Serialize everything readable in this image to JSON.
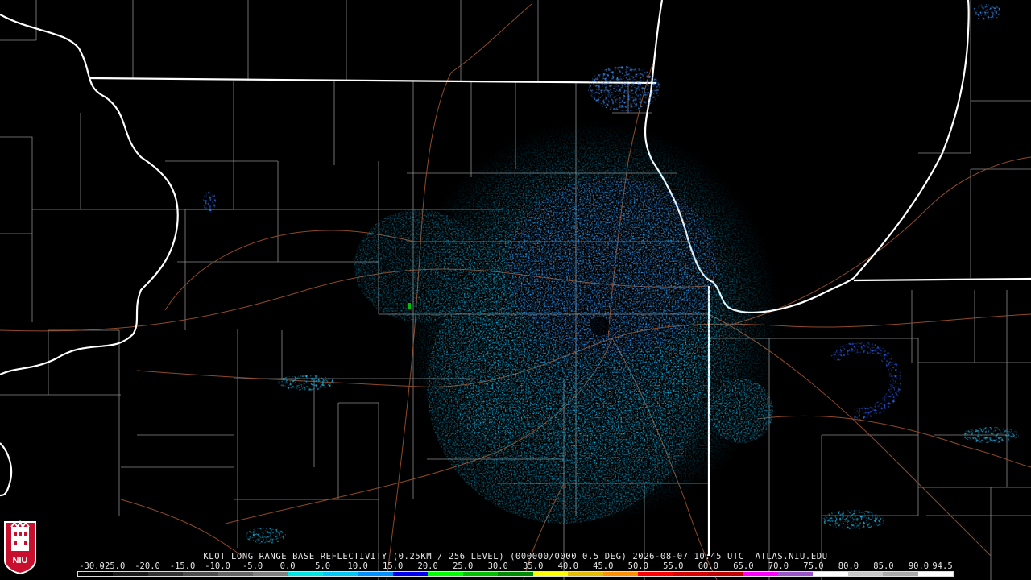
{
  "product_line": {
    "station": "KLOT",
    "product": "LONG RANGE BASE REFLECTIVITY",
    "resolution": "(0.25KM / 256 LEVEL)",
    "volume": "(000000/0000 0.5 DEG)",
    "datetime": "2026-08-07 10:45 UTC",
    "source": "ATLAS.NIU.EDU"
  },
  "color_scale": {
    "labels": [
      "-30.0",
      "-25.0",
      "-20.0",
      "-15.0",
      "-10.0",
      "-5.0",
      "0.0",
      "5.0",
      "10.0",
      "15.0",
      "20.0",
      "25.0",
      "30.0",
      "35.0",
      "40.0",
      "45.0",
      "50.0",
      "55.0",
      "60.0",
      "65.0",
      "70.0",
      "75.0",
      "80.0",
      "85.0",
      "90.0",
      "94.5"
    ],
    "colors": [
      "#000000",
      "#1a1a1a",
      "#333333",
      "#4d4d4d",
      "#666666",
      "#808080",
      "#00e5e5",
      "#00c8f5",
      "#0090ff",
      "#0000f0",
      "#00ff00",
      "#00c000",
      "#008c00",
      "#ffff00",
      "#e6bc00",
      "#ff9000",
      "#ff0000",
      "#d60000",
      "#c00000",
      "#ff00ff",
      "#9955c9",
      "#ffffff",
      "#c8c8c8",
      "#aaaaaa",
      "#ffffff"
    ]
  },
  "logo": {
    "text": "NIU",
    "color": "#c8102e"
  },
  "map_colors": {
    "state_lines": "#ffffff",
    "county_lines": "#8c8c8c",
    "highways": "#a0522d",
    "echo_light": "#19b4e6",
    "echo_mid": "#3c8cf0",
    "echo_dark": "#2a5ef0"
  }
}
